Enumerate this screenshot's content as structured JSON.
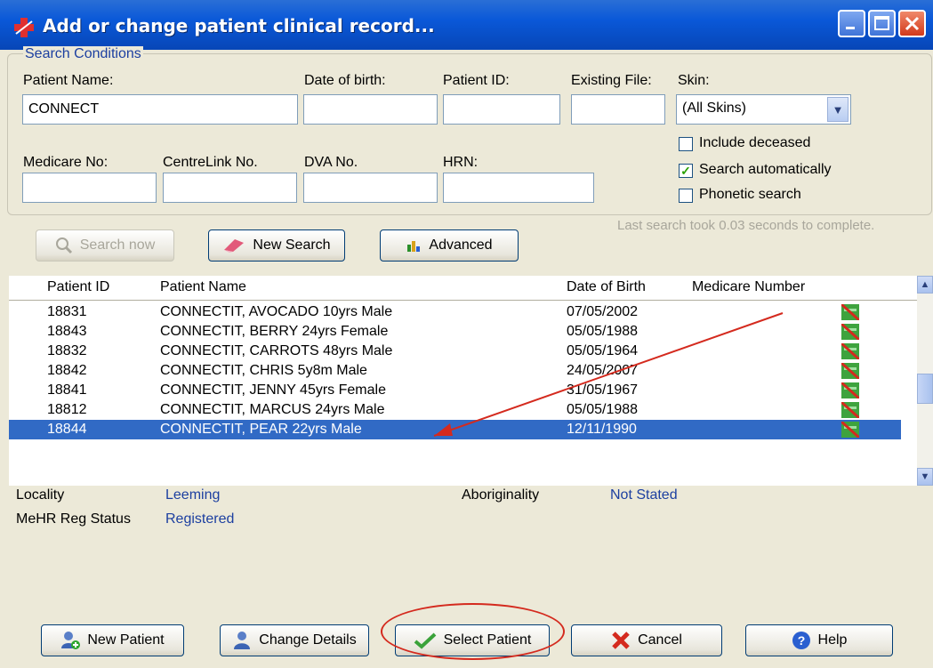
{
  "window": {
    "title": "Add or change patient clinical record..."
  },
  "search_conditions": {
    "legend": "Search Conditions",
    "patient_name_label": "Patient Name:",
    "patient_name_value": "CONNECT",
    "dob_label": "Date of birth:",
    "dob_value": "",
    "patient_id_label": "Patient ID:",
    "patient_id_value": "",
    "existing_file_label": "Existing File:",
    "existing_file_value": "",
    "skin_label": "Skin:",
    "skin_value": "(All Skins)",
    "medicare_label": "Medicare No:",
    "centrelink_label": "CentreLink No.",
    "dva_label": "DVA No.",
    "hrn_label": "HRN:",
    "include_deceased_label": "Include deceased",
    "include_deceased_checked": false,
    "search_auto_label": "Search automatically",
    "search_auto_checked": true,
    "phonetic_label": "Phonetic search",
    "phonetic_checked": false
  },
  "actions": {
    "search_now": "Search now",
    "new_search": "New Search",
    "advanced": "Advanced",
    "status": "Last search took 0.03 seconds to complete."
  },
  "grid": {
    "columns": [
      "Patient ID",
      "Patient Name",
      "Date of Birth",
      "Medicare Number"
    ],
    "rows": [
      {
        "id": "18831",
        "name": "CONNECTIT, AVOCADO 10yrs Male",
        "dob": "07/05/2002",
        "medicare": ""
      },
      {
        "id": "18843",
        "name": "CONNECTIT, BERRY 24yrs Female",
        "dob": "05/05/1988",
        "medicare": ""
      },
      {
        "id": "18832",
        "name": "CONNECTIT, CARROTS 48yrs Male",
        "dob": "05/05/1964",
        "medicare": ""
      },
      {
        "id": "18842",
        "name": "CONNECTIT, CHRIS 5y8m Male",
        "dob": "24/05/2007",
        "medicare": ""
      },
      {
        "id": "18841",
        "name": "CONNECTIT, JENNY 45yrs Female",
        "dob": "31/05/1967",
        "medicare": ""
      },
      {
        "id": "18812",
        "name": "CONNECTIT, MARCUS 24yrs Male",
        "dob": "05/05/1988",
        "medicare": ""
      },
      {
        "id": "18844",
        "name": "CONNECTIT, PEAR 22yrs Male",
        "dob": "12/11/1990",
        "medicare": ""
      }
    ],
    "selected_row_index": 6
  },
  "details": {
    "locality_label": "Locality",
    "locality_value": "Leeming",
    "aboriginality_label": "Aboriginality",
    "aboriginality_value": "Not Stated",
    "mehr_label": "MeHR Reg Status",
    "mehr_value": "Registered"
  },
  "footer": {
    "new_patient": "New Patient",
    "change_details": "Change Details",
    "select_patient": "Select Patient",
    "cancel": "Cancel",
    "help": "Help"
  },
  "colors": {
    "titlebar": "#0a58d8",
    "selection": "#316ac5",
    "link_text": "#1c3fa0",
    "annotation": "#d42a1e"
  }
}
